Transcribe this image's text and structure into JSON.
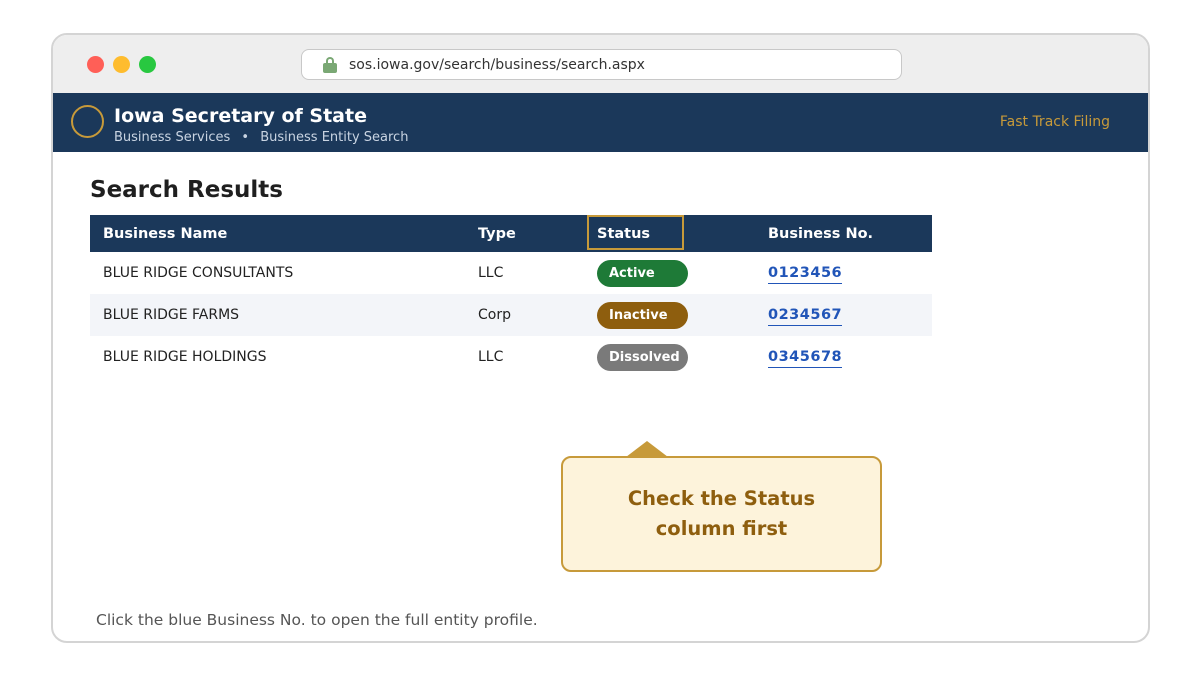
{
  "browser": {
    "url": "sos.iowa.gov/search/business/search.aspx"
  },
  "header": {
    "title": "Iowa Secretary of State",
    "breadcrumb": [
      "Business Services",
      "Business Entity Search"
    ],
    "breadcrumb_separator": "•",
    "fast_track": "Fast Track Filing"
  },
  "main": {
    "title": "Search Results",
    "columns": [
      "Business Name",
      "Type",
      "Status",
      "Business No."
    ],
    "rows": [
      {
        "name": "BLUE RIDGE CONSULTANTS",
        "type": "LLC",
        "status": "Active",
        "number": "0123456"
      },
      {
        "name": "BLUE RIDGE FARMS",
        "type": "Corp",
        "status": "Inactive",
        "number": "0234567"
      },
      {
        "name": "BLUE RIDGE HOLDINGS",
        "type": "LLC",
        "status": "Dissolved",
        "number": "0345678"
      }
    ],
    "callout": "Check the Status column first",
    "footer_hint": "Click the blue Business No. to open the full entity profile."
  },
  "colors": {
    "header_navy": "#1b385a",
    "accent_gold": "#c79a3a",
    "status_active": "#1e7a37",
    "status_inactive": "#8e5e0e",
    "status_dissolved": "#7a7a7a",
    "link_blue": "#2155b8"
  }
}
